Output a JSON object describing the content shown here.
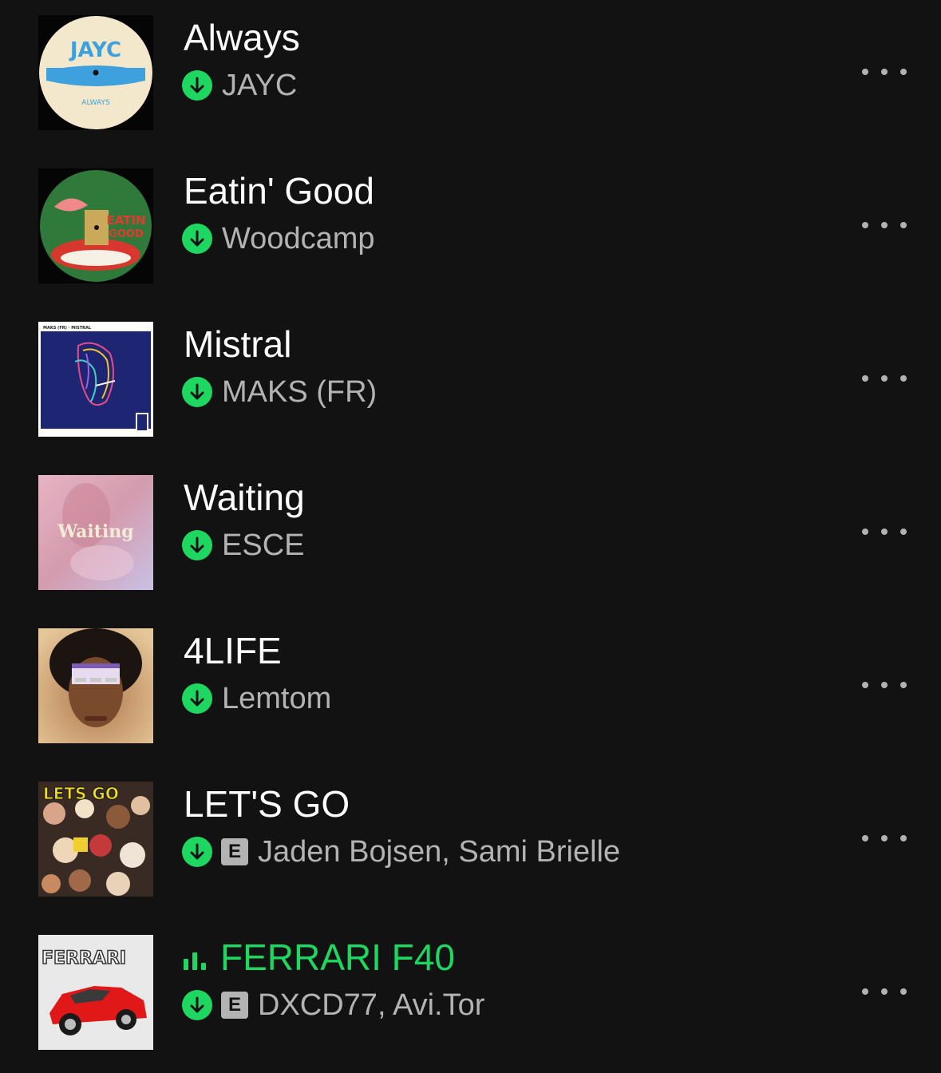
{
  "tracks": [
    {
      "title": "Always",
      "artist": "JAYC",
      "explicit": false,
      "playing": false,
      "cover_icon": "jayc-record-cover",
      "cover_text": "JAYC"
    },
    {
      "title": "Eatin' Good",
      "artist": "Woodcamp",
      "explicit": false,
      "playing": false,
      "cover_icon": "spaghetti-record-cover",
      "cover_text": "EATIN GOOD"
    },
    {
      "title": "Mistral",
      "artist": "MAKS (FR)",
      "explicit": false,
      "playing": false,
      "cover_icon": "neon-face-cover",
      "cover_text": "MAKS (FR) · MISTRAL"
    },
    {
      "title": "Waiting",
      "artist": "ESCE",
      "explicit": false,
      "playing": false,
      "cover_icon": "pastel-waiting-cover",
      "cover_text": "Waiting"
    },
    {
      "title": "4LIFE",
      "artist": "Lemtom",
      "explicit": false,
      "playing": false,
      "cover_icon": "afro-portrait-cover",
      "cover_text": ""
    },
    {
      "title": "LET'S GO",
      "artist": "Jaden Bojsen, Sami Brielle",
      "explicit": true,
      "playing": false,
      "cover_icon": "party-collage-cover",
      "cover_text": "LETS GO"
    },
    {
      "title": "FERRARI F40",
      "artist": "DXCD77, Avi.Tor",
      "explicit": true,
      "playing": true,
      "cover_icon": "red-ferrari-cover",
      "cover_text": "FERRARI"
    }
  ],
  "explicit_label": "E",
  "colors": {
    "background": "#121212",
    "accent": "#1ed760",
    "secondary_text": "#b3b3b3"
  }
}
